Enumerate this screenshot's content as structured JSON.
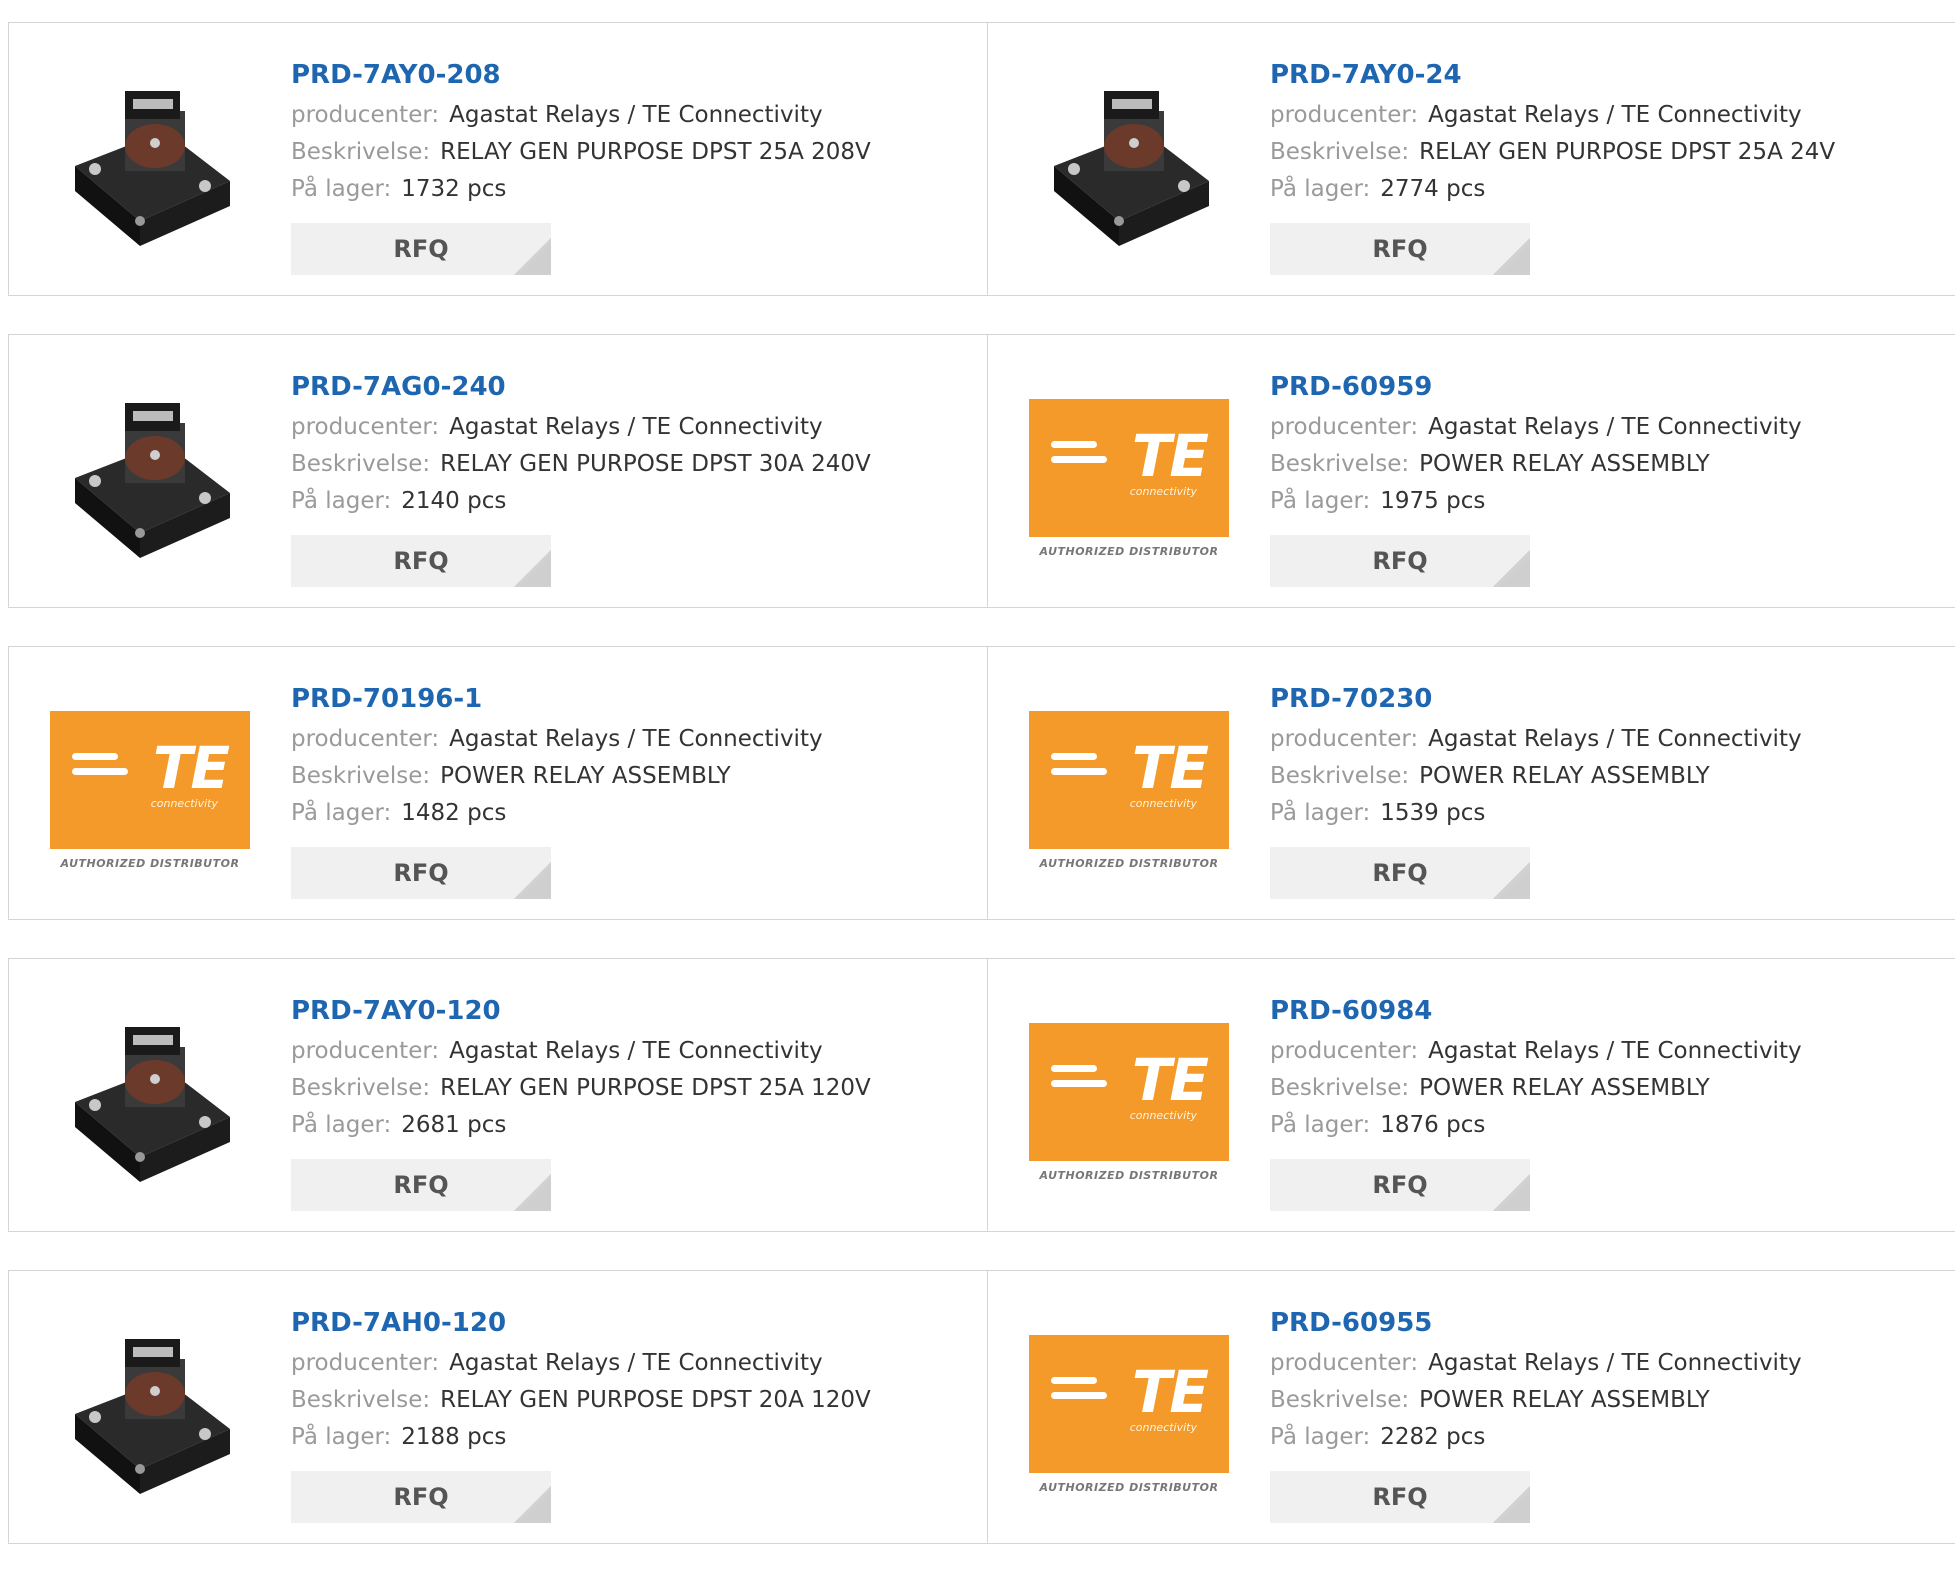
{
  "labels": {
    "manufacturer": "producenter:",
    "description": "Beskrivelse:",
    "stock": "På lager:",
    "rfq": "RFQ"
  },
  "te_logo": {
    "brand": "TE",
    "sub": "connectivity",
    "caption": "AUTHORIZED DISTRIBUTOR"
  },
  "colors": {
    "part_link": "#1f66b0",
    "te_orange": "#f39a2b"
  },
  "products": [
    {
      "part": "PRD-7AY0-208",
      "manufacturer": "Agastat Relays / TE Connectivity",
      "description": "RELAY GEN PURPOSE DPST 25A 208V",
      "stock": "1732 pcs",
      "image": "relay"
    },
    {
      "part": "PRD-7AY0-24",
      "manufacturer": "Agastat Relays / TE Connectivity",
      "description": "RELAY GEN PURPOSE DPST 25A 24V",
      "stock": "2774 pcs",
      "image": "relay"
    },
    {
      "part": "PRD-7AG0-240",
      "manufacturer": "Agastat Relays / TE Connectivity",
      "description": "RELAY GEN PURPOSE DPST 30A 240V",
      "stock": "2140 pcs",
      "image": "relay"
    },
    {
      "part": "PRD-60959",
      "manufacturer": "Agastat Relays / TE Connectivity",
      "description": "POWER RELAY ASSEMBLY",
      "stock": "1975 pcs",
      "image": "te-logo"
    },
    {
      "part": "PRD-70196-1",
      "manufacturer": "Agastat Relays / TE Connectivity",
      "description": "POWER RELAY ASSEMBLY",
      "stock": "1482 pcs",
      "image": "te-logo"
    },
    {
      "part": "PRD-70230",
      "manufacturer": "Agastat Relays / TE Connectivity",
      "description": "POWER RELAY ASSEMBLY",
      "stock": "1539 pcs",
      "image": "te-logo"
    },
    {
      "part": "PRD-7AY0-120",
      "manufacturer": "Agastat Relays / TE Connectivity",
      "description": "RELAY GEN PURPOSE DPST 25A 120V",
      "stock": "2681 pcs",
      "image": "relay"
    },
    {
      "part": "PRD-60984",
      "manufacturer": "Agastat Relays / TE Connectivity",
      "description": "POWER RELAY ASSEMBLY",
      "stock": "1876 pcs",
      "image": "te-logo"
    },
    {
      "part": "PRD-7AH0-120",
      "manufacturer": "Agastat Relays / TE Connectivity",
      "description": "RELAY GEN PURPOSE DPST 20A 120V",
      "stock": "2188 pcs",
      "image": "relay"
    },
    {
      "part": "PRD-60955",
      "manufacturer": "Agastat Relays / TE Connectivity",
      "description": "POWER RELAY ASSEMBLY",
      "stock": "2282 pcs",
      "image": "te-logo"
    }
  ]
}
